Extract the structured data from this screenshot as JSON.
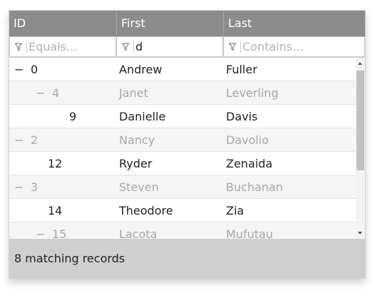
{
  "columns": [
    {
      "header": "ID"
    },
    {
      "header": "First"
    },
    {
      "header": "Last"
    }
  ],
  "filters": [
    {
      "value": "",
      "placeholder": "Equals..."
    },
    {
      "value": "d",
      "placeholder": ""
    },
    {
      "value": "",
      "placeholder": "Contains..."
    }
  ],
  "rows": [
    {
      "toggle": "−",
      "id": "0",
      "first": "Andrew",
      "last": "Fuller"
    },
    {
      "toggle": "−",
      "id": "4",
      "first": "Janet",
      "last": "Leverling"
    },
    {
      "toggle": "",
      "id": "9",
      "first": "Danielle",
      "last": "Davis"
    },
    {
      "toggle": "−",
      "id": "2",
      "first": "Nancy",
      "last": "Davolio"
    },
    {
      "toggle": "",
      "id": "12",
      "first": "Ryder",
      "last": "Zenaida"
    },
    {
      "toggle": "−",
      "id": "3",
      "first": "Steven",
      "last": "Buchanan"
    },
    {
      "toggle": "",
      "id": "14",
      "first": "Theodore",
      "last": "Zia"
    },
    {
      "toggle": "−",
      "id": "15",
      "first": "Lacota",
      "last": "Mufutau"
    }
  ],
  "footer": {
    "status": "8 matching records"
  },
  "icons": {
    "filter": "filter-funnel-icon",
    "scroll_up": "scroll-up-arrow-icon",
    "scroll_down": "scroll-down-arrow-icon"
  },
  "colors": {
    "header_bg": "#8c8c8c",
    "footer_bg": "#cfcfcf",
    "dim_text": "#a6a6a6"
  }
}
